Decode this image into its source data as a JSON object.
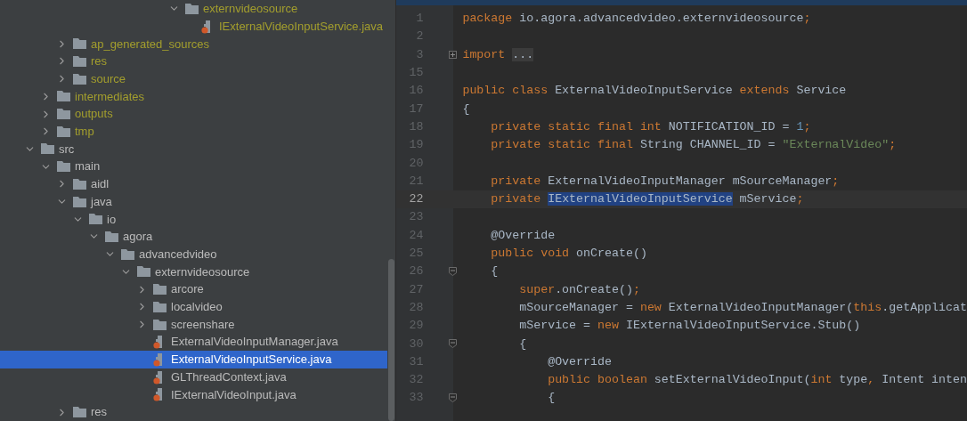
{
  "tree": {
    "items": [
      {
        "children": [
          {
            "children": [
              {
                "children": [
                  {
                    "children": [
                      {
                        "children": [
                          {
                            "children": [
                              {
                                "children": [
                                  {
                                    "children": [
                                      {
                                        "children": [
                                          {
                                            "label": "externvideosource",
                                            "kind": "folder",
                                            "expanded": true,
                                            "excluded": true,
                                            "selected": false,
                                            "children": [
                                              {
                                                "label": "IExternalVideoInputService.java",
                                                "kind": "java_file",
                                                "excluded": true,
                                                "selected": false
                                              }
                                            ]
                                          }
                                        ]
                                      }
                                    ]
                                  }
                                ]
                              }
                            ]
                          }
                        ]
                      }
                    ]
                  }
                ]
              },
              {
                "label": "ap_generated_sources",
                "kind": "folder",
                "expanded": false,
                "excluded": true,
                "selected": false
              },
              {
                "label": "res",
                "kind": "folder",
                "expanded": false,
                "excluded": true,
                "selected": false
              },
              {
                "label": "source",
                "kind": "folder",
                "expanded": false,
                "excluded": true,
                "selected": false
              }
            ]
          },
          {
            "label": "intermediates",
            "kind": "folder",
            "expanded": false,
            "excluded": true,
            "selected": false
          },
          {
            "label": "outputs",
            "kind": "folder",
            "expanded": false,
            "excluded": true,
            "selected": false
          },
          {
            "label": "tmp",
            "kind": "folder",
            "expanded": false,
            "excluded": true,
            "selected": false
          }
        ]
      },
      {
        "label": "src",
        "kind": "folder",
        "expanded": true,
        "excluded": false,
        "selected": false,
        "children": [
          {
            "label": "main",
            "kind": "folder",
            "expanded": true,
            "excluded": false,
            "selected": false,
            "children": [
              {
                "label": "aidl",
                "kind": "folder",
                "expanded": false,
                "excluded": false,
                "selected": false
              },
              {
                "label": "java",
                "kind": "folder",
                "expanded": true,
                "excluded": false,
                "selected": false,
                "children": [
                  {
                    "label": "io",
                    "kind": "folder",
                    "expanded": true,
                    "excluded": false,
                    "selected": false,
                    "children": [
                      {
                        "label": "agora",
                        "kind": "folder",
                        "expanded": true,
                        "excluded": false,
                        "selected": false,
                        "children": [
                          {
                            "label": "advancedvideo",
                            "kind": "folder",
                            "expanded": true,
                            "excluded": false,
                            "selected": false,
                            "children": [
                              {
                                "label": "externvideosource",
                                "kind": "folder",
                                "expanded": true,
                                "excluded": false,
                                "selected": false,
                                "children": [
                                  {
                                    "label": "arcore",
                                    "kind": "folder",
                                    "expanded": false,
                                    "excluded": false,
                                    "selected": false
                                  },
                                  {
                                    "label": "localvideo",
                                    "kind": "folder",
                                    "expanded": false,
                                    "excluded": false,
                                    "selected": false
                                  },
                                  {
                                    "label": "screenshare",
                                    "kind": "folder",
                                    "expanded": false,
                                    "excluded": false,
                                    "selected": false
                                  },
                                  {
                                    "label": "ExternalVideoInputManager.java",
                                    "kind": "java_file",
                                    "excluded": false,
                                    "selected": false
                                  },
                                  {
                                    "label": "ExternalVideoInputService.java",
                                    "kind": "java_file",
                                    "excluded": false,
                                    "selected": true
                                  },
                                  {
                                    "label": "GLThreadContext.java",
                                    "kind": "java_file",
                                    "excluded": false,
                                    "selected": false
                                  },
                                  {
                                    "label": "IExternalVideoInput.java",
                                    "kind": "java_file",
                                    "excluded": false,
                                    "selected": false
                                  }
                                ]
                              }
                            ]
                          }
                        ]
                      }
                    ]
                  }
                ]
              },
              {
                "label": "res",
                "kind": "folder",
                "expanded": false,
                "excluded": false,
                "selected": false
              }
            ]
          }
        ]
      }
    ]
  },
  "editor": {
    "lines": [
      {
        "number": "1",
        "current": false,
        "tokens": [
          {
            "text": "package ",
            "kind": "kw"
          },
          {
            "text": "io.agora.advancedvideo.externvideosource",
            "kind": "id"
          },
          {
            "text": ";",
            "kind": "kw"
          }
        ]
      },
      {
        "number": "2",
        "current": false
      },
      {
        "number": "3",
        "current": false,
        "collapsed": true,
        "tokens": [
          {
            "text": "import ",
            "kind": "kw"
          },
          {
            "text": "...",
            "kind": "folded"
          }
        ]
      },
      {
        "number": "15",
        "current": false
      },
      {
        "number": "16",
        "current": false,
        "tokens": [
          {
            "text": "public class ",
            "kind": "kw"
          },
          {
            "text": "ExternalVideoInputService ",
            "kind": "id"
          },
          {
            "text": "extends ",
            "kind": "kw"
          },
          {
            "text": "Service",
            "kind": "id"
          }
        ]
      },
      {
        "number": "17",
        "current": false,
        "tokens": [
          {
            "text": "{",
            "kind": "id"
          }
        ]
      },
      {
        "number": "18",
        "current": false,
        "tokens": [
          {
            "text": "    private static final int ",
            "kind": "kw"
          },
          {
            "text": "NOTIFICATION_ID = ",
            "kind": "id"
          },
          {
            "text": "1",
            "kind": "num"
          },
          {
            "text": ";",
            "kind": "kw"
          }
        ]
      },
      {
        "number": "19",
        "current": false,
        "tokens": [
          {
            "text": "    private static final ",
            "kind": "kw"
          },
          {
            "text": "String CHANNEL_ID = ",
            "kind": "id"
          },
          {
            "text": "\"ExternalVideo\"",
            "kind": "str"
          },
          {
            "text": ";",
            "kind": "kw"
          }
        ]
      },
      {
        "number": "20",
        "current": false
      },
      {
        "number": "21",
        "current": false,
        "tokens": [
          {
            "text": "    private ",
            "kind": "kw"
          },
          {
            "text": "ExternalVideoInputManager mSourceManager",
            "kind": "id"
          },
          {
            "text": ";",
            "kind": "kw"
          }
        ]
      },
      {
        "number": "22",
        "current": true,
        "tokens": [
          {
            "text": "    private ",
            "kind": "kw"
          },
          {
            "text": "IExternalVideoInputService",
            "kind": "selection"
          },
          {
            "text": " mService",
            "kind": "id"
          },
          {
            "text": ";",
            "kind": "kw"
          }
        ]
      },
      {
        "number": "23",
        "current": false
      },
      {
        "number": "24",
        "current": false,
        "tokens": [
          {
            "text": "    @Override",
            "kind": "id"
          }
        ]
      },
      {
        "number": "25",
        "current": false,
        "tokens": [
          {
            "text": "    public void ",
            "kind": "kw"
          },
          {
            "text": "onCreate()",
            "kind": "id"
          }
        ]
      },
      {
        "number": "26",
        "current": false,
        "collapsed": false,
        "tokens": [
          {
            "text": "    {",
            "kind": "id"
          }
        ]
      },
      {
        "number": "27",
        "current": false,
        "tokens": [
          {
            "text": "        super",
            "kind": "kw"
          },
          {
            "text": ".onCreate()",
            "kind": "id"
          },
          {
            "text": ";",
            "kind": "kw"
          }
        ]
      },
      {
        "number": "28",
        "current": false,
        "tokens": [
          {
            "text": "        mSourceManager = ",
            "kind": "id"
          },
          {
            "text": "new ",
            "kind": "kw"
          },
          {
            "text": "ExternalVideoInputManager(",
            "kind": "id"
          },
          {
            "text": "this",
            "kind": "kw"
          },
          {
            "text": ".getApplicat",
            "kind": "id"
          }
        ]
      },
      {
        "number": "29",
        "current": false,
        "tokens": [
          {
            "text": "        mService = ",
            "kind": "id"
          },
          {
            "text": "new ",
            "kind": "kw"
          },
          {
            "text": "IExternalVideoInputService.Stub()",
            "kind": "id"
          }
        ]
      },
      {
        "number": "30",
        "current": false,
        "collapsed": false,
        "tokens": [
          {
            "text": "        {",
            "kind": "id"
          }
        ]
      },
      {
        "number": "31",
        "current": false,
        "tokens": [
          {
            "text": "            @Override",
            "kind": "id"
          }
        ]
      },
      {
        "number": "32",
        "current": false,
        "tokens": [
          {
            "text": "            public boolean ",
            "kind": "kw"
          },
          {
            "text": "setExternalVideoInput(",
            "kind": "id"
          },
          {
            "text": "int ",
            "kind": "kw"
          },
          {
            "text": "type",
            "kind": "id"
          },
          {
            "text": ", ",
            "kind": "kw"
          },
          {
            "text": "Intent inten",
            "kind": "id"
          }
        ]
      },
      {
        "number": "33",
        "current": false,
        "collapsed": false,
        "tokens": [
          {
            "text": "            {",
            "kind": "id"
          }
        ]
      }
    ]
  }
}
